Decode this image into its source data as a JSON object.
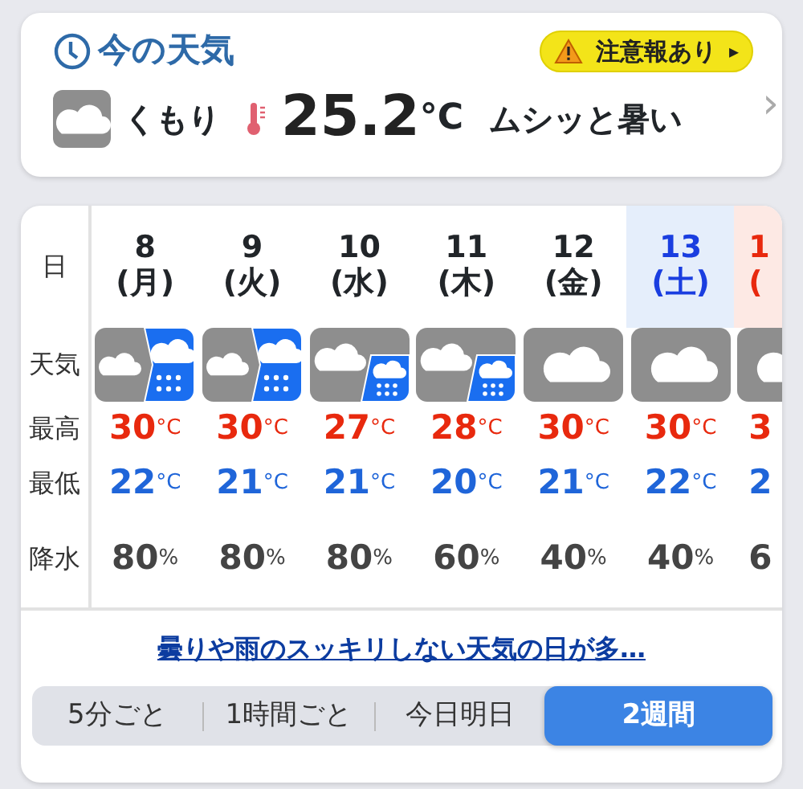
{
  "current": {
    "title": "今の天気",
    "alert": {
      "label": "注意報あり",
      "arrow": "▸"
    },
    "condition": "くもり",
    "temperature": "25.2",
    "unit": "°C",
    "comment": "ムシッと暑い",
    "chevron": "›"
  },
  "forecast": {
    "row_labels": [
      "日",
      "天気",
      "最高",
      "最低",
      "降水"
    ],
    "days": [
      {
        "date": "8",
        "weekday": "(月)",
        "kind": "weekday",
        "weather": {
          "kind": "cloudy-then-rain"
        },
        "high": "30",
        "high_unit": "°C",
        "low": "22",
        "low_unit": "°C",
        "rain": "80",
        "rain_unit": "%"
      },
      {
        "date": "9",
        "weekday": "(火)",
        "kind": "weekday",
        "weather": {
          "kind": "cloudy-then-rain"
        },
        "high": "30",
        "high_unit": "°C",
        "low": "21",
        "low_unit": "°C",
        "rain": "80",
        "rain_unit": "%"
      },
      {
        "date": "10",
        "weekday": "(水)",
        "kind": "weekday",
        "weather": {
          "kind": "cloudy-sometimes-rain"
        },
        "high": "27",
        "high_unit": "°C",
        "low": "21",
        "low_unit": "°C",
        "rain": "80",
        "rain_unit": "%"
      },
      {
        "date": "11",
        "weekday": "(木)",
        "kind": "weekday",
        "weather": {
          "kind": "cloudy-sometimes-rain"
        },
        "high": "28",
        "high_unit": "°C",
        "low": "20",
        "low_unit": "°C",
        "rain": "60",
        "rain_unit": "%"
      },
      {
        "date": "12",
        "weekday": "(金)",
        "kind": "weekday",
        "weather": {
          "kind": "cloudy"
        },
        "high": "30",
        "high_unit": "°C",
        "low": "21",
        "low_unit": "°C",
        "rain": "40",
        "rain_unit": "%"
      },
      {
        "date": "13",
        "weekday": "(土)",
        "kind": "saturday",
        "weather": {
          "kind": "cloudy"
        },
        "high": "30",
        "high_unit": "°C",
        "low": "22",
        "low_unit": "°C",
        "rain": "40",
        "rain_unit": "%"
      },
      {
        "date": "1",
        "weekday": "(",
        "kind": "sunday",
        "weather": {
          "kind": "cloudy"
        },
        "high": "3",
        "low": "2",
        "rain": "6"
      }
    ],
    "summary_link": "曇りや雨のスッキリしない天気の日が多…"
  },
  "tabs": [
    {
      "label": "5分ごと",
      "selected": false
    },
    {
      "label": "1時間ごと",
      "selected": false
    },
    {
      "label": "今日明日",
      "selected": false
    },
    {
      "label": "2週間",
      "selected": true
    }
  ]
}
